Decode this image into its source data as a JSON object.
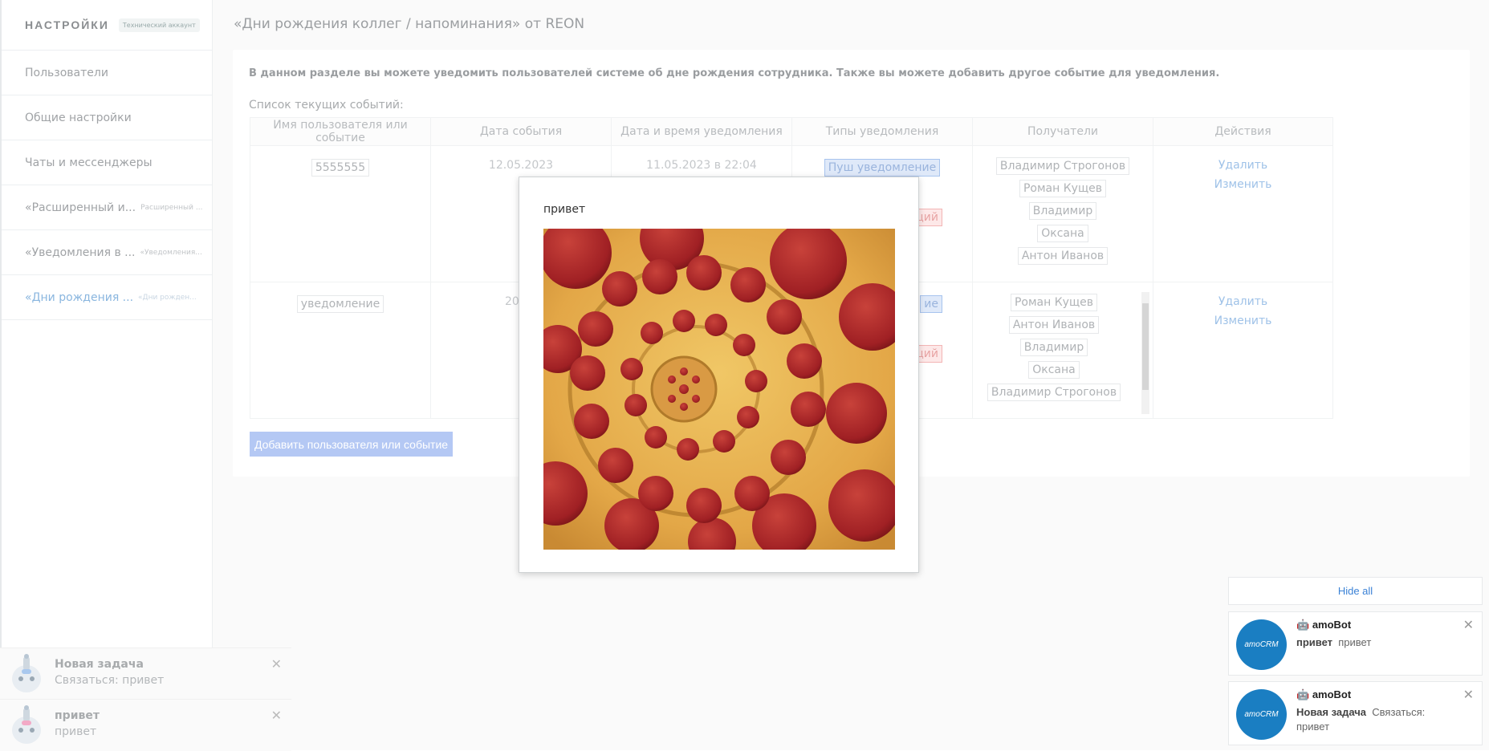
{
  "sidebar": {
    "title": "НАСТРОЙКИ",
    "badge": "Технический аккаунт",
    "items": [
      {
        "label": "Пользователи",
        "sub": ""
      },
      {
        "label": "Общие настройки",
        "sub": ""
      },
      {
        "label": "Чаты и мессенджеры",
        "sub": ""
      },
      {
        "label": "«Расширенный и...",
        "sub": "Расширенный ..."
      },
      {
        "label": "«Уведомления в ...",
        "sub": "«Уведомления..."
      },
      {
        "label": "«Дни рождения ...",
        "sub": "«Дни рожден..."
      }
    ]
  },
  "main": {
    "title": "«Дни рождения коллег / напоминания» от REON",
    "intro": "В данном разделе вы можете уведомить пользователей системе об дне рождения сотрудника. Также вы можете добавить другое событие для уведомления.",
    "list_label": "Список текущих событий:",
    "columns": [
      "Имя пользователя или событие",
      "Дата события",
      "Дата и время уведомления",
      "Типы уведомления",
      "Получатели",
      "Действия"
    ],
    "rows": [
      {
        "name": "5555555",
        "event_date": "12.05.2023",
        "notify_datetime": "11.05.2023 в 22:04",
        "type_push": "Пуш уведомление",
        "type_partial": "ций",
        "recipients": [
          "Владимир Строгонов",
          "Роман Кущев",
          "Владимир",
          "Оксана",
          "Антон Иванов"
        ],
        "delete": "Удалить",
        "edit": "Изменить"
      },
      {
        "name": "уведомление",
        "event_date": "20.05",
        "type_push": "ие",
        "type_partial": "ций",
        "recipients": [
          "Роман Кущев",
          "Антон Иванов",
          "Владимир",
          "Оксана",
          "Владимир Строгонов"
        ],
        "delete": "Удалить",
        "edit": "Изменить"
      }
    ],
    "add_button": "Добавить пользователя или событие"
  },
  "modal": {
    "text": "привет",
    "image": "pepperoni-pizza-photo"
  },
  "bottom_left_notifications": [
    {
      "title": "Новая задача",
      "subtitle": "Связаться: привет"
    },
    {
      "title": "привет",
      "subtitle": "привет"
    }
  ],
  "bottom_right": {
    "hide_all": "Hide all",
    "notifications": [
      {
        "sender": "amoBot",
        "bold": "привет",
        "text": "привет",
        "avatar": "amoCRM"
      },
      {
        "sender": "amoBot",
        "bold": "Новая задача",
        "text": "Связаться: привет",
        "avatar": "amoCRM"
      }
    ]
  },
  "colors": {
    "accent_blue": "#3b82d6",
    "avatar_blue": "#1a7ec2",
    "push_tag_bg": "#dfe9f9",
    "red_tag_bg": "#fde8e8"
  }
}
